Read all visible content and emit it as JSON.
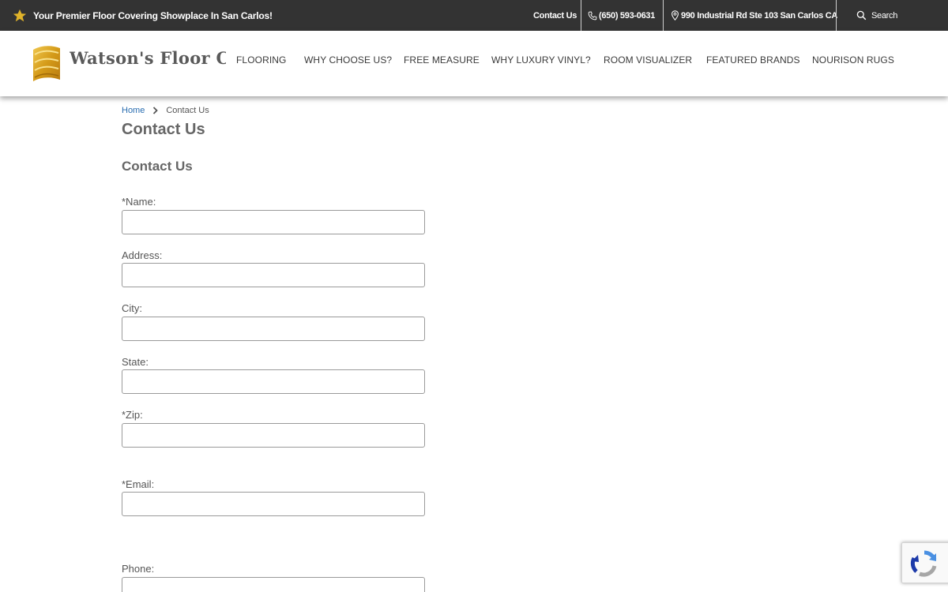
{
  "topbar": {
    "promo_text": "Your Premier Floor Covering Showplace In San Carlos!",
    "contact_label": "Contact Us",
    "phone": "(650) 593-0631",
    "address": "990 Industrial Rd Ste 103 San Carlos CA",
    "search_label": "Search"
  },
  "header": {
    "logo_text": "Watson's Floor Coverings",
    "nav": [
      "FLOORING",
      "WHY CHOOSE US?",
      "FREE MEASURE",
      "WHY LUXURY VINYL?",
      "ROOM VISUALIZER",
      "FEATURED BRANDS",
      "NOURISON RUGS"
    ]
  },
  "breadcrumb": {
    "home": "Home",
    "current": "Contact Us"
  },
  "page_title": "Contact Us",
  "form": {
    "title": "Contact Us",
    "fields": [
      {
        "label": "*Name:",
        "value": ""
      },
      {
        "label": "Address:",
        "value": ""
      },
      {
        "label": "City:",
        "value": ""
      },
      {
        "label": "State:",
        "value": ""
      },
      {
        "label": "*Zip:",
        "value": ""
      },
      {
        "label": "*Email:",
        "value": ""
      },
      {
        "label": "Phone:",
        "value": ""
      }
    ]
  },
  "colors": {
    "topbar_bg": "#333333",
    "link_blue": "#2a6db0",
    "logo_gold": "#d8a520"
  }
}
